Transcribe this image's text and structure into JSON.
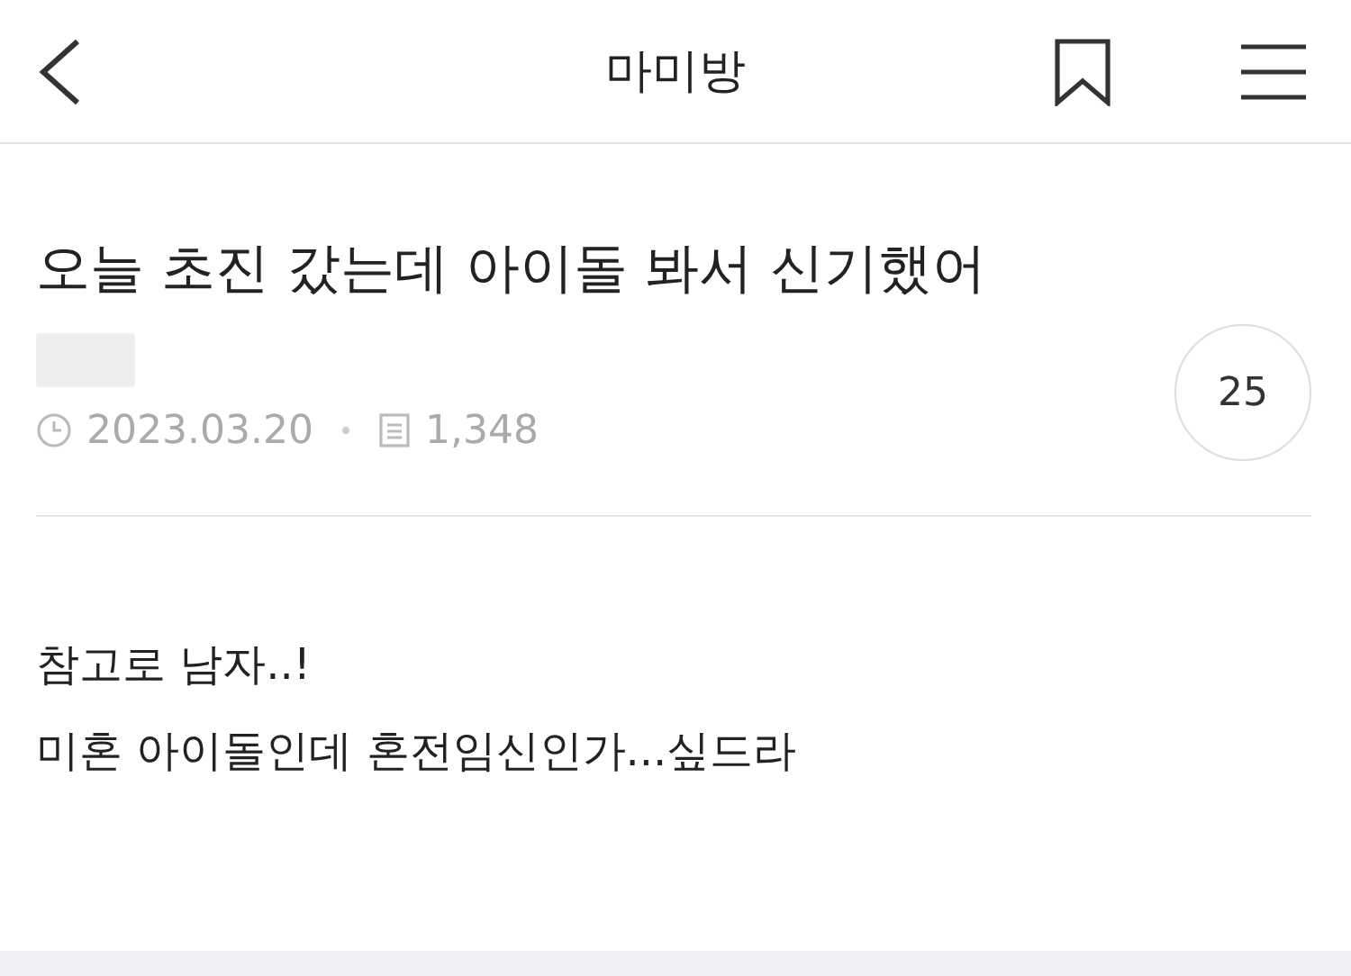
{
  "header": {
    "title": "마미방"
  },
  "post": {
    "title": "오늘 초진 갔는데 아이돌 봐서 신기했어",
    "date": "2023.03.20",
    "views": "1,348",
    "comments": "25",
    "body": [
      "참고로 남자..!",
      "미혼 아이돌인데 혼전임신인가...싶드라"
    ]
  }
}
